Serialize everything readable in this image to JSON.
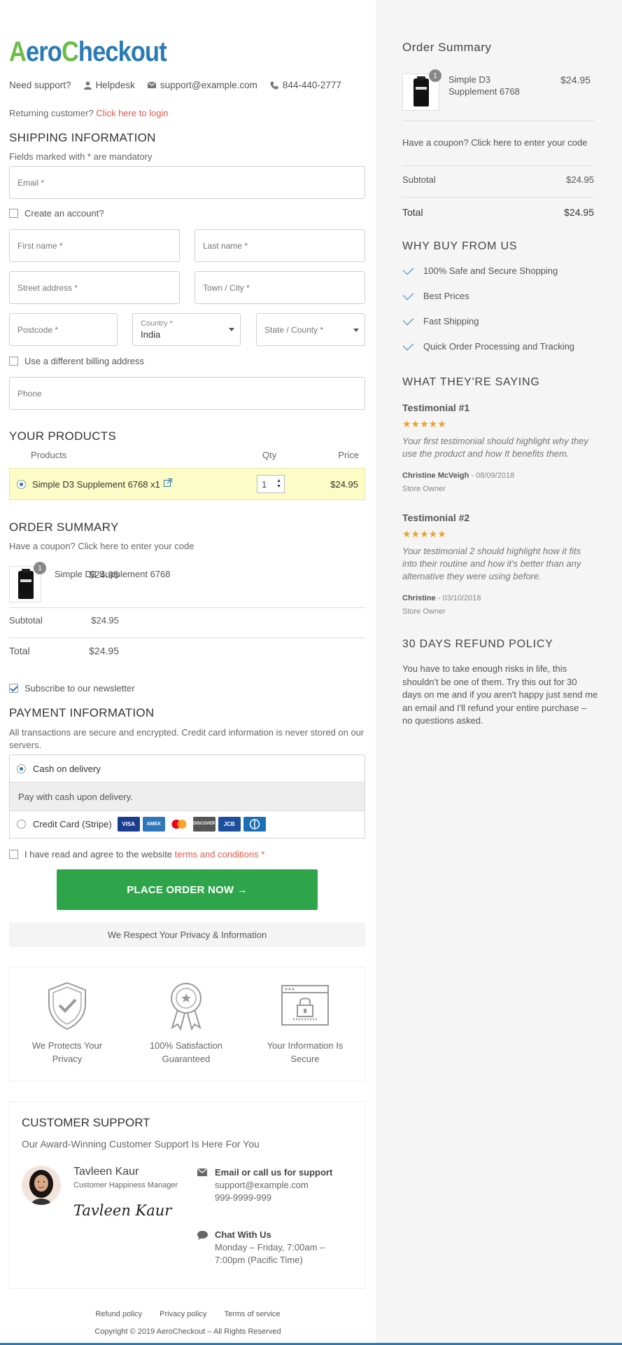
{
  "logo": {
    "part1_a": "A",
    "part1_b": "ero",
    "part2_a": "C",
    "part2_b": "heckout"
  },
  "support": {
    "label": "Need support?",
    "helpdesk": "Helpdesk",
    "email": "support@example.com",
    "phone": "844-440-2777"
  },
  "returning": {
    "text": "Returning customer?",
    "link": "Click here to login"
  },
  "shipping": {
    "title": "SHIPPING INFORMATION",
    "note": "Fields marked with * are mandatory",
    "email_placeholder": "Email *",
    "create_account": "Create an account?",
    "first_name": "First name *",
    "last_name": "Last name *",
    "street": "Street address *",
    "city": "Town / City *",
    "postcode": "Postcode *",
    "country_label": "Country *",
    "country_value": "India",
    "state": "State / County *",
    "billing": "Use a different billing address",
    "phone": "Phone"
  },
  "products": {
    "title": "YOUR PRODUCTS",
    "col_products": "Products",
    "col_qty": "Qty",
    "col_price": "Price",
    "item_name": "Simple D3 Supplement 6768 x1",
    "item_qty": "1",
    "item_price": "$24.95"
  },
  "order_summary": {
    "title": "ORDER SUMMARY",
    "coupon": "Have a coupon? Click here to enter your code",
    "item_name": "Simple D3 Supplement 6768",
    "item_price": "$24.95",
    "item_count": "1",
    "subtotal_label": "Subtotal",
    "subtotal": "$24.95",
    "total_label": "Total",
    "total": "$24.95"
  },
  "newsletter": "Subscribe to our newsletter",
  "payment": {
    "title": "PAYMENT INFORMATION",
    "note": "All transactions are secure and encrypted. Credit card information is never stored on our servers.",
    "cod": "Cash on delivery",
    "cod_desc": "Pay with cash upon delivery.",
    "stripe": "Credit Card (Stripe)",
    "cards": [
      "VISA",
      "AMEX",
      "MC",
      "DISCOVER",
      "JCB",
      "DINERS"
    ]
  },
  "terms": {
    "prefix": "I have read and agree to the website",
    "link": "terms and conditions",
    "star": "*"
  },
  "place_order": "PLACE ORDER NOW →",
  "privacy_bar": "We Respect Your Privacy & Information",
  "trust": [
    {
      "line1": "We Protects Your",
      "line2": "Privacy"
    },
    {
      "line1": "100% Satisfaction",
      "line2": "Guaranteed"
    },
    {
      "line1": "Your Information Is",
      "line2": "Secure"
    }
  ],
  "customer_support": {
    "title": "CUSTOMER SUPPORT",
    "subtitle": "Our Award-Winning Customer Support Is Here For You",
    "name": "Tavleen Kaur",
    "role": "Customer Happiness Manager",
    "signature": "Tavleen Kaur",
    "email_title": "Email or call us for support",
    "email": "support@example.com",
    "phone": "999-9999-999",
    "chat_title": "Chat With Us",
    "chat_hours_1": "Monday – Friday, 7:00am –",
    "chat_hours_2": "7:00pm (Pacific Time)"
  },
  "footer": {
    "refund": "Refund policy",
    "privacy": "Privacy policy",
    "terms": "Terms of service",
    "copyright": "Copyright © 2019 AeroCheckout – All Rights Reserved"
  },
  "sidebar": {
    "order_summary_title": "Order Summary",
    "item_name_1": "Simple D3",
    "item_name_2": "Supplement 6768",
    "item_price": "$24.95",
    "item_count": "1",
    "coupon": "Have a coupon? Click here to enter your code",
    "subtotal_label": "Subtotal",
    "subtotal": "$24.95",
    "total_label": "Total",
    "total": "$24.95",
    "why_title": "WHY BUY FROM US",
    "why_items": [
      "100% Safe and Secure Shopping",
      "Best Prices",
      "Fast Shipping",
      "Quick Order Processing and Tracking"
    ],
    "saying_title": "WHAT THEY'RE SAYING",
    "testimonials": [
      {
        "title": "Testimonial #1",
        "stars": "★★★★★",
        "q1": "Your first testimonial should highlight why they",
        "q2": "use the product and how It benefits them.",
        "name": "Christine McVeigh",
        "date": " - 08/09/2018",
        "role": "Store Owner"
      },
      {
        "title": "Testimonial #2",
        "stars": "★★★★★",
        "q1": "Your testimonial 2 should highlight how it fits",
        "q2": "into their routine and how it's better than any",
        "q3": "alternative they were using before.",
        "name": "Christine",
        "date": " - 03/10/2018",
        "role": "Store Owner"
      }
    ],
    "refund_title": "30 DAYS REFUND POLICY",
    "refund_lines": [
      "You have to take enough risks in life, this",
      "shouldn't be one of them. Try this out for 30",
      "days on me and if you aren't happy just send me",
      "an email and I'll refund your entire purchase –",
      "no questions asked."
    ]
  },
  "colors": {
    "brand_green": "#6cbd45",
    "brand_blue": "#2a7ab8",
    "button_green": "#2ea54b",
    "link_red": "#e05a4a",
    "star": "#f0a020"
  }
}
